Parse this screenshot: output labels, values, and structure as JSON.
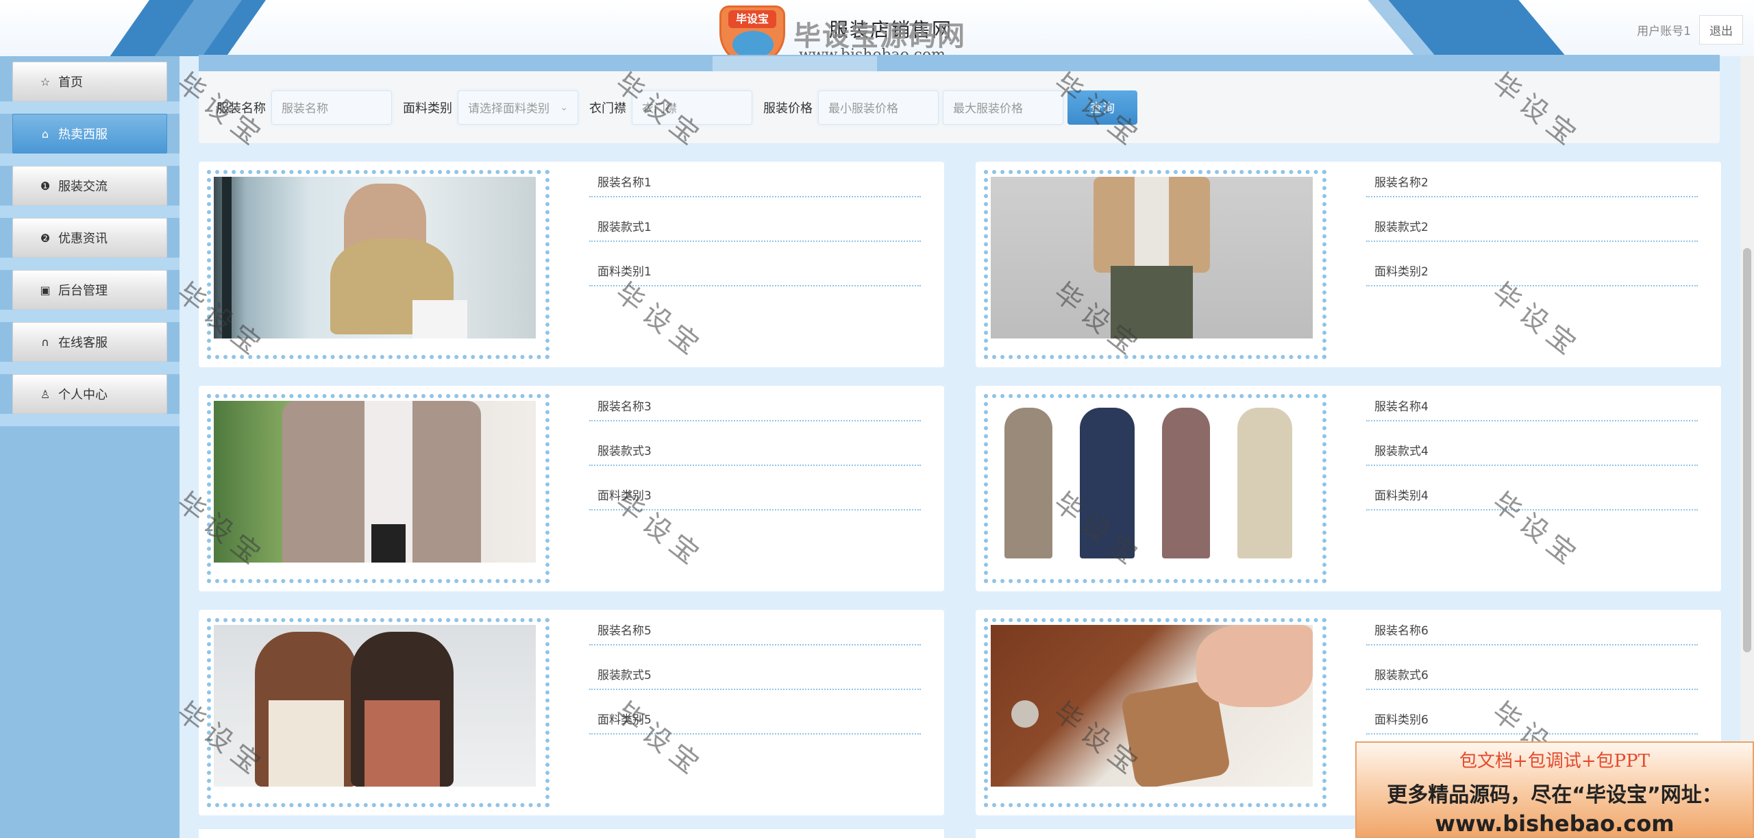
{
  "header": {
    "site_title": "服装店销售网",
    "logo_badge": "毕设宝",
    "logo_name": "毕设宝源码网",
    "logo_url": "www.bishebao.com",
    "user_label": "用户账号1",
    "logout_label": "退出"
  },
  "sidebar": {
    "items": [
      {
        "label": "首页",
        "icon": "star-icon"
      },
      {
        "label": "热卖西服",
        "icon": "bag-icon",
        "active": true
      },
      {
        "label": "服装交流",
        "icon": "info-icon"
      },
      {
        "label": "优惠资讯",
        "icon": "help-icon"
      },
      {
        "label": "后台管理",
        "icon": "briefcase-icon"
      },
      {
        "label": "在线客服",
        "icon": "headset-icon"
      },
      {
        "label": "个人中心",
        "icon": "user-icon"
      }
    ]
  },
  "search": {
    "name_label": "服装名称",
    "name_placeholder": "服装名称",
    "fabric_label": "面料类别",
    "fabric_placeholder": "请选择面料类别",
    "placket_label": "衣门襟",
    "placket_placeholder": "衣门襟",
    "price_label": "服装价格",
    "min_price_placeholder": "最小服装价格",
    "max_price_placeholder": "最大服装价格",
    "query_label": "查询"
  },
  "products": [
    {
      "name": "服装名称1",
      "style": "服装款式1",
      "fabric": "面料类别1"
    },
    {
      "name": "服装名称2",
      "style": "服装款式2",
      "fabric": "面料类别2"
    },
    {
      "name": "服装名称3",
      "style": "服装款式3",
      "fabric": "面料类别3"
    },
    {
      "name": "服装名称4",
      "style": "服装款式4",
      "fabric": "面料类别4"
    },
    {
      "name": "服装名称5",
      "style": "服装款式5",
      "fabric": "面料类别5"
    },
    {
      "name": "服装名称6",
      "style": "服装款式6",
      "fabric": "面料类别6"
    }
  ],
  "watermark": "毕设宝",
  "promo": {
    "line1": "包文档+包调试+包PPT",
    "line2": "更多精品源码，尽在“毕设宝”网址：",
    "line3": "www.bishebao.com"
  },
  "colors": {
    "accent": "#3c8ccd",
    "sidebar_bg": "#8fc0e4",
    "dotted_border": "#8fc4e8"
  }
}
